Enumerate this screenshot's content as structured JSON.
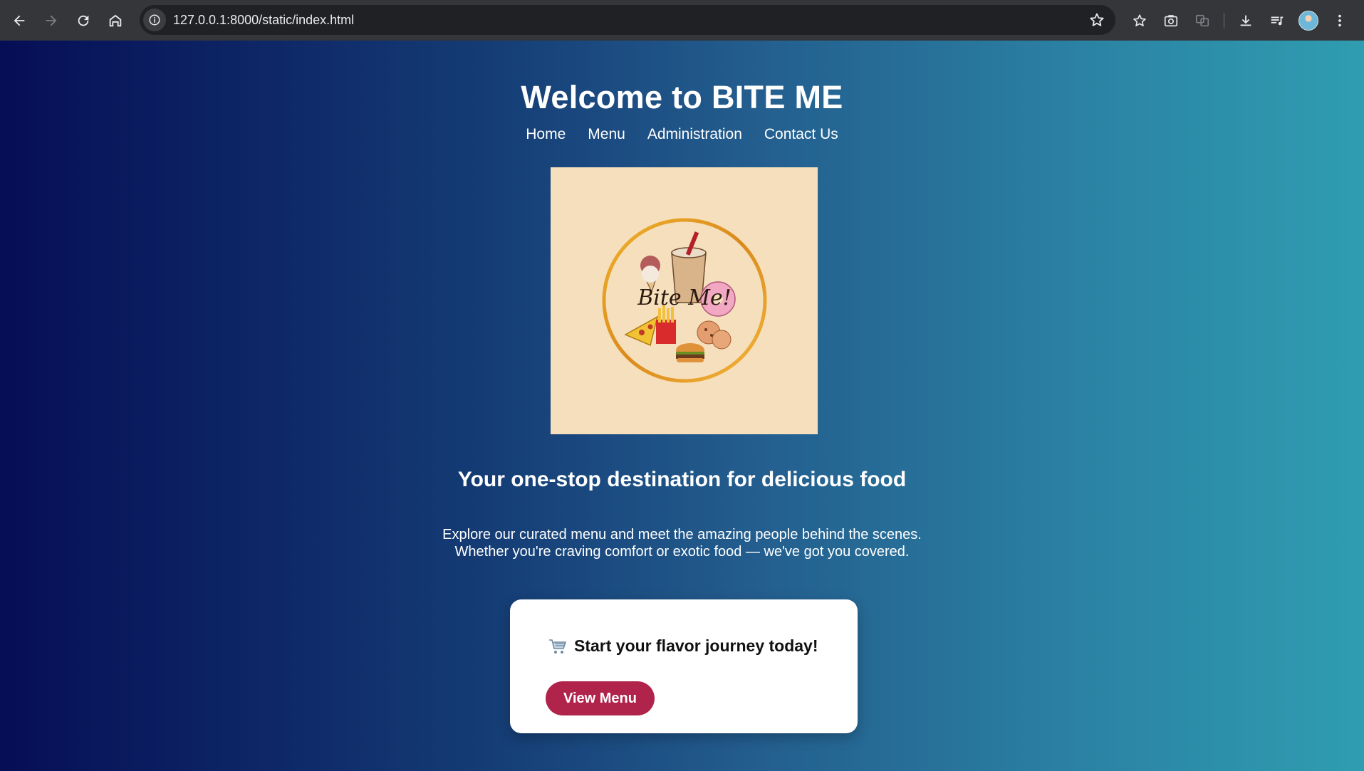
{
  "browser": {
    "url": "127.0.0.1:8000/static/index.html"
  },
  "page": {
    "title": "Welcome to BITE ME",
    "nav": {
      "home": "Home",
      "menu": "Menu",
      "administration": "Administration",
      "contact": "Contact Us"
    },
    "logo": {
      "text": "Bite Me!",
      "background": "#f6dfbc"
    },
    "tagline": "Your one-stop destination for delicious food",
    "intro_line1": "Explore our curated menu and meet the amazing people behind the scenes.",
    "intro_line2": "Whether you're craving comfort or exotic food — we've got you covered.",
    "cta": {
      "icon": "shopping-cart-icon",
      "text": "Start your flavor journey today!",
      "button_label": "View Menu",
      "button_color": "#b0244c"
    }
  },
  "colors": {
    "gradient_left": "#060e55",
    "gradient_right": "#2f9db1"
  }
}
